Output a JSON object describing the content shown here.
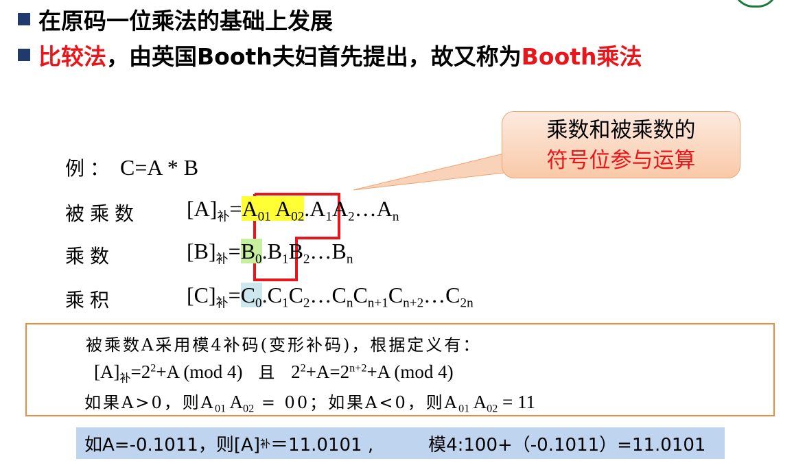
{
  "bullets": {
    "line1": "在原码一位乘法的基础上发展",
    "line2_red1": "比较法",
    "line2_mid": "，由英国Booth夫妇首先提出，故又称为",
    "line2_red2": "Booth乘法"
  },
  "callout": {
    "line1": "乘数和被乘数的",
    "line2": "符号位参与运算"
  },
  "example": {
    "label": "例：",
    "formula": "C=A * B"
  },
  "multiplicand": {
    "label": "被乘数",
    "lhs": "[A]",
    "lhs_sub": "补",
    "eq": "=",
    "s1": "A",
    "s1_sub": "01",
    "s2": "A",
    "s2_sub": "02",
    "rest": [
      {
        "t": ".A",
        "s": "1"
      },
      {
        "t": "A",
        "s": "2"
      },
      {
        "t": "…A",
        "s": "n"
      }
    ]
  },
  "multiplier": {
    "label": "乘数",
    "lhs": "[B]",
    "lhs_sub": "补",
    "eq": "=",
    "s1": "B",
    "s1_sub": "0",
    "rest": [
      {
        "t": ".B",
        "s": "1"
      },
      {
        "t": "B",
        "s": "2"
      },
      {
        "t": "…B",
        "s": "n"
      }
    ]
  },
  "product": {
    "label": "乘积",
    "lhs": "[C]",
    "lhs_sub": "补",
    "eq": "=",
    "s1": "C",
    "s1_sub": "0",
    "rest": [
      {
        "t": ".C",
        "s": "1"
      },
      {
        "t": "C",
        "s": "2"
      },
      {
        "t": "…C",
        "s": "n"
      },
      {
        "t": "C",
        "s": "n+1"
      },
      {
        "t": "C",
        "s": "n+2"
      },
      {
        "t": "…C",
        "s": "2n"
      }
    ]
  },
  "box": {
    "line1": "被乘数A采用模4补码(变形补码)，根据定义有：",
    "line2_a": "[A]",
    "line2_a_sub": "补",
    "line2_b": "=2",
    "line2_b_sup": "2",
    "line2_c": "+A (mod 4)",
    "line2_and": "且",
    "line2_d": "2",
    "line2_d_sup": "2",
    "line2_e": "+A=2",
    "line2_e_sup": "n+2",
    "line2_f": "+A (mod 4)",
    "line3_a": "如果A>0，则A",
    "line3_a_sub1": "01",
    "line3_a2": " A",
    "line3_a_sub2": "02",
    "line3_b": " = 00；如果A<0，则A",
    "line3_b_sub1": "01",
    "line3_b2": " A",
    "line3_b_sub2": "02",
    "line3_c": " = 11"
  },
  "bottom": {
    "part1": "如A=-0.1011，则[A]",
    "part1_sub": "补",
    "part2": "＝11.0101 ,",
    "part3": "模4:100+（-0.1011）=11.0101"
  },
  "colors": {
    "accent_red": "#e8151b",
    "bullet": "#1f3a6b",
    "box_border": "#f08a3c",
    "band": "#bfd4ee"
  }
}
